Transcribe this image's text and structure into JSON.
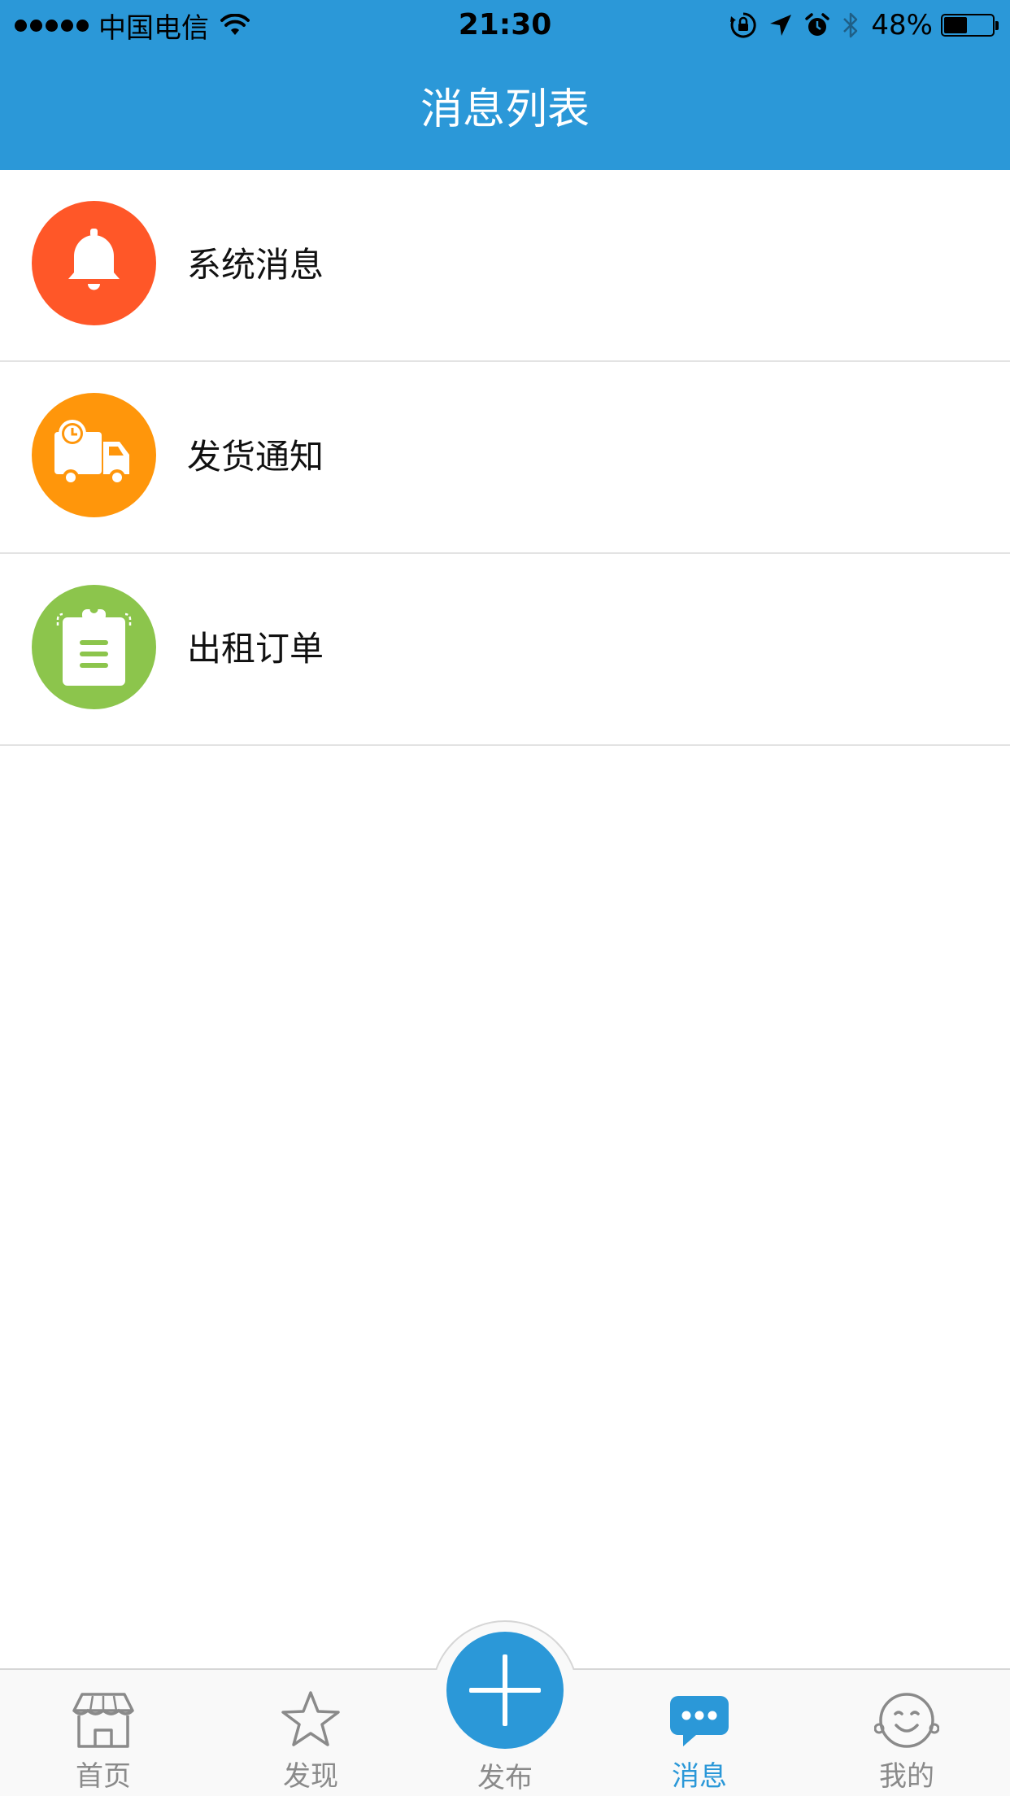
{
  "status_bar": {
    "carrier": "中国电信",
    "time": "21:30",
    "battery_percent": "48%",
    "battery_level": 0.48,
    "icons": [
      "signal-dots",
      "wifi-icon",
      "orientation-lock-icon",
      "location-arrow-icon",
      "alarm-icon",
      "bluetooth-icon",
      "battery-icon"
    ]
  },
  "header": {
    "title": "消息列表"
  },
  "messages": [
    {
      "label": "系统消息",
      "icon": "bell-icon",
      "color": "#FF5728"
    },
    {
      "label": "发货通知",
      "icon": "delivery-truck-icon",
      "color": "#FF960B"
    },
    {
      "label": "出租订单",
      "icon": "clipboard-icon",
      "color": "#8CC54C"
    }
  ],
  "tab_bar": {
    "accent": "#2B98D8",
    "inactive_color": "#8a8a8a",
    "active_tab": "消息",
    "tabs": [
      {
        "label": "首页",
        "icon": "shop-icon"
      },
      {
        "label": "发现",
        "icon": "star-icon"
      },
      {
        "label": "发布",
        "icon": "plus-icon"
      },
      {
        "label": "消息",
        "icon": "chat-bubble-icon"
      },
      {
        "label": "我的",
        "icon": "smiley-face-icon"
      }
    ]
  }
}
